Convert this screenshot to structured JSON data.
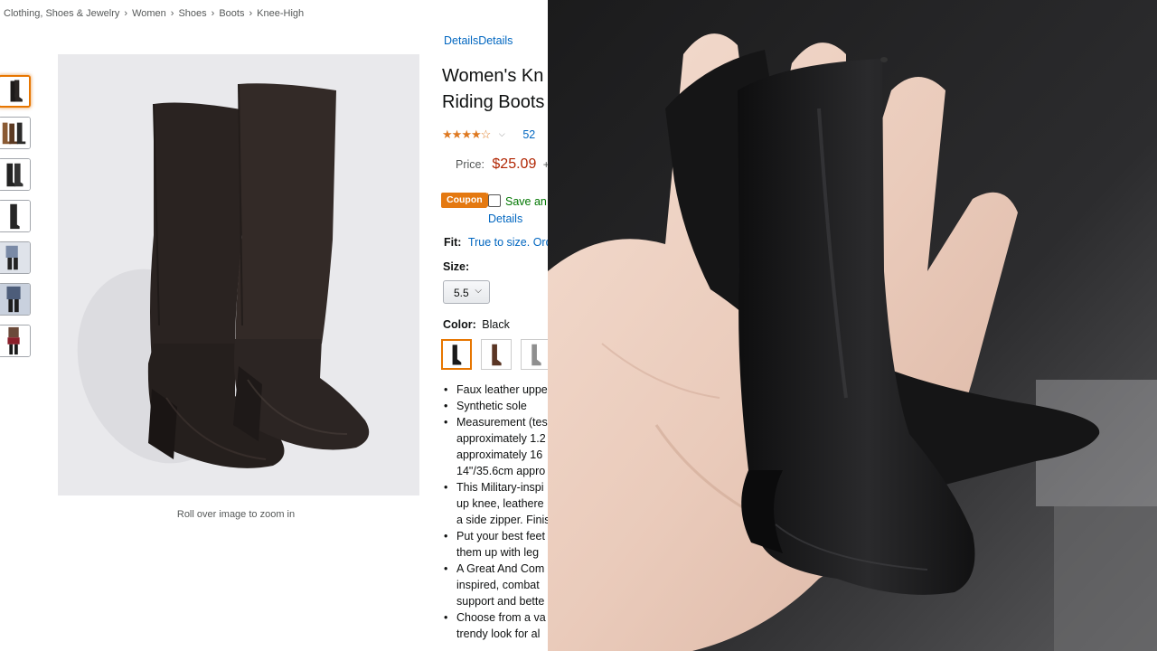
{
  "breadcrumb": {
    "items": [
      "Clothing, Shoes & Jewelry",
      "Women",
      "Shoes",
      "Boots",
      "Knee-High"
    ],
    "separator": "›"
  },
  "gallery": {
    "thumbnail_count": 7,
    "selected_index": 0,
    "zoom_hint": "Roll over image to zoom in"
  },
  "product": {
    "details_link": "DetailsDetails",
    "title_line1": "Women's Kn",
    "title_line2": "Riding Boots",
    "rating_stars": 4,
    "review_count": "52",
    "price_label": "Price:",
    "price_value": "$25.09",
    "price_suffix": "+",
    "coupon_badge": "Coupon",
    "coupon_text": "Save an",
    "coupon_details": "Details",
    "fit_label": "Fit:",
    "fit_value": "True to size. Ord",
    "size_label": "Size:",
    "size_selected": "5.5",
    "color_label": "Color:",
    "color_value": "Black",
    "swatch_colors": [
      "#1a1a1a",
      "#5a3524",
      "#8f8f8f"
    ],
    "bullets": [
      "Faux leather uppe",
      "Synthetic sole",
      "Measurement (tes",
      "approximately 1.2",
      "approximately 16",
      "14\"/35.6cm appro",
      "This Military-inspi",
      "up knee, leathere",
      "a side zipper. Finis",
      "Put your best feet",
      "them up with leg",
      "A Great And Com",
      "inspired, combat",
      "support and bette",
      "Choose from a va",
      "trendy look for al"
    ]
  },
  "colors": {
    "link": "#0066c0",
    "price": "#b12704",
    "accent": "#e47911",
    "coupon_text": "#007600",
    "star": "#de7921"
  }
}
